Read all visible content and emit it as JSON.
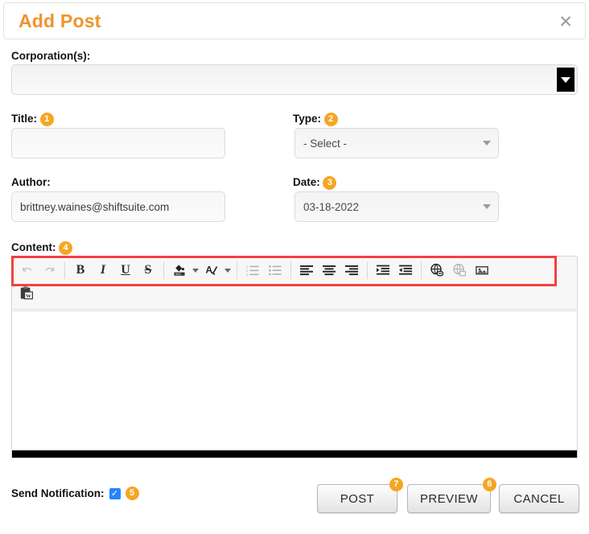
{
  "dialog": {
    "title": "Add Post",
    "close_icon": "close-icon"
  },
  "fields": {
    "corporations": {
      "label": "Corporation(s):",
      "value": "",
      "dropdown_icon": "chevron-down-icon"
    },
    "title": {
      "label": "Title:",
      "badge": "1",
      "value": "",
      "placeholder": ""
    },
    "type": {
      "label": "Type:",
      "badge": "2",
      "value": "- Select -",
      "dropdown_icon": "chevron-down-icon"
    },
    "author": {
      "label": "Author:",
      "value": "brittney.waines@shiftsuite.com"
    },
    "date": {
      "label": "Date:",
      "badge": "3",
      "value": "03-18-2022",
      "dropdown_icon": "chevron-down-icon"
    },
    "content": {
      "label": "Content:",
      "badge": "4",
      "value": ""
    }
  },
  "toolbar": {
    "row1": [
      {
        "name": "undo-icon",
        "title": "Undo",
        "disabled": true
      },
      {
        "name": "redo-icon",
        "title": "Redo",
        "disabled": true
      },
      {
        "name": "bold-icon",
        "title": "Bold",
        "label": "B"
      },
      {
        "name": "italic-icon",
        "title": "Italic",
        "label": "I"
      },
      {
        "name": "underline-icon",
        "title": "Underline",
        "label": "U"
      },
      {
        "name": "strikethrough-icon",
        "title": "Strikethrough",
        "label": "S"
      },
      {
        "name": "background-color-icon",
        "title": "Background Color"
      },
      {
        "name": "text-color-icon",
        "title": "Text Color"
      },
      {
        "name": "numbered-list-icon",
        "title": "Insert/Remove Numbered List"
      },
      {
        "name": "bulleted-list-icon",
        "title": "Insert/Remove Bulleted List"
      },
      {
        "name": "align-left-icon",
        "title": "Align Left"
      },
      {
        "name": "align-center-icon",
        "title": "Center"
      },
      {
        "name": "align-right-icon",
        "title": "Align Right"
      },
      {
        "name": "increase-indent-icon",
        "title": "Increase Indent"
      },
      {
        "name": "decrease-indent-icon",
        "title": "Decrease Indent"
      },
      {
        "name": "link-icon",
        "title": "Link"
      },
      {
        "name": "unlink-icon",
        "title": "Unlink",
        "disabled": true
      },
      {
        "name": "image-icon",
        "title": "Image"
      }
    ],
    "row2": [
      {
        "name": "paste-from-word-icon",
        "title": "Paste from Word"
      }
    ]
  },
  "footer": {
    "notification_label": "Send Notification:",
    "notification_checked": true,
    "notification_badge": "5",
    "post_label": "POST",
    "post_badge": "7",
    "preview_label": "PREVIEW",
    "preview_badge": "6",
    "cancel_label": "CANCEL"
  },
  "colors": {
    "accent": "#f0932b",
    "badge": "#f5a623",
    "checkbox": "#2684ff",
    "highlight": "#f4413f"
  }
}
